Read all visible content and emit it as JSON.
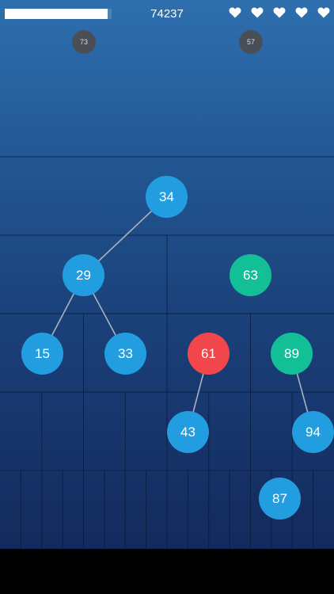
{
  "hud": {
    "progress_fraction": 0.96,
    "score": "74237",
    "lives": 5
  },
  "incoming": [
    {
      "value": "73"
    },
    {
      "value": "57"
    }
  ],
  "colors": {
    "node_blue": "#229ee0",
    "node_green": "#12bf96",
    "node_red": "#f1474c",
    "incoming_gray": "#4a4f57",
    "edge": "#a9b3bf"
  },
  "tree": {
    "nodes": [
      {
        "id": "n34",
        "value": "34",
        "color": "blue"
      },
      {
        "id": "n29",
        "value": "29",
        "color": "blue"
      },
      {
        "id": "n63",
        "value": "63",
        "color": "green"
      },
      {
        "id": "n15",
        "value": "15",
        "color": "blue"
      },
      {
        "id": "n33",
        "value": "33",
        "color": "blue"
      },
      {
        "id": "n61",
        "value": "61",
        "color": "red"
      },
      {
        "id": "n89",
        "value": "89",
        "color": "green"
      },
      {
        "id": "n43",
        "value": "43",
        "color": "blue"
      },
      {
        "id": "n94",
        "value": "94",
        "color": "blue"
      },
      {
        "id": "n87",
        "value": "87",
        "color": "blue"
      }
    ],
    "edges": [
      [
        "n34",
        "n29"
      ],
      [
        "n29",
        "n15"
      ],
      [
        "n29",
        "n33"
      ],
      [
        "n61",
        "n43"
      ],
      [
        "n89",
        "n94"
      ]
    ]
  }
}
